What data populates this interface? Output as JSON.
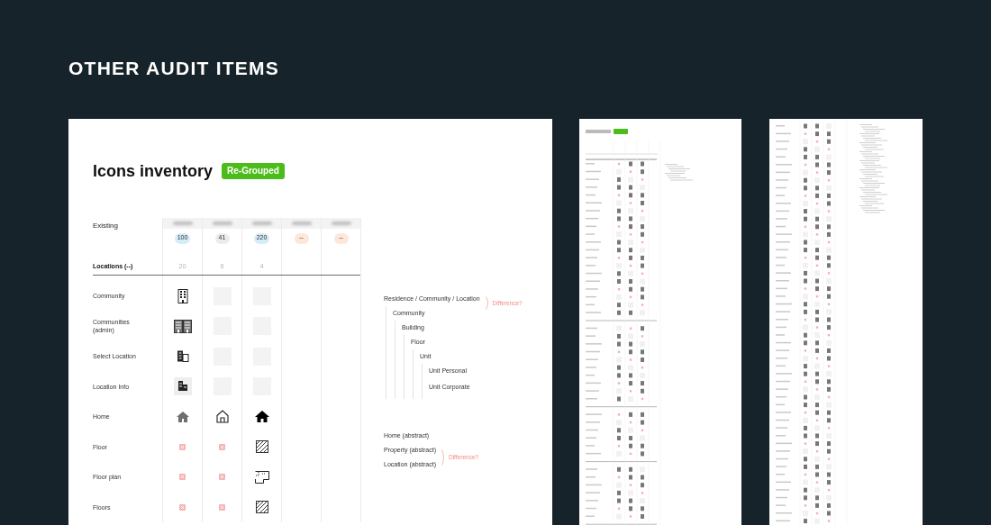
{
  "section_title": "OTHER AUDIT ITEMS",
  "inventory": {
    "title": "Icons inventory",
    "tag": "Re-Grouped",
    "table": {
      "row_header": "Existing",
      "columns": [
        {
          "badge": "100",
          "color": "#d6edf8"
        },
        {
          "badge": "41",
          "color": "#ececec"
        },
        {
          "badge": "220",
          "color": "#d6edf8"
        },
        {
          "badge": "--",
          "color": "#fde7d8"
        },
        {
          "badge": "--",
          "color": "#fde7d8"
        }
      ],
      "group": {
        "label": "Locations (--)",
        "counts": [
          "20",
          "6",
          "4"
        ]
      },
      "rows": [
        {
          "label": "Community",
          "cells": [
            {
              "kind": "tower"
            },
            {
              "kind": "placeholder"
            },
            {
              "kind": "placeholder"
            }
          ]
        },
        {
          "label": "Communities (admin)",
          "cells": [
            {
              "kind": "towers"
            },
            {
              "kind": "placeholder"
            },
            {
              "kind": "placeholder"
            }
          ]
        },
        {
          "label": "Select Location",
          "cells": [
            {
              "kind": "office"
            },
            {
              "kind": "placeholder"
            },
            {
              "kind": "placeholder"
            }
          ]
        },
        {
          "label": "Location Info",
          "cells": [
            {
              "kind": "office-boxed"
            },
            {
              "kind": "placeholder"
            },
            {
              "kind": "placeholder"
            }
          ]
        },
        {
          "label": "Home",
          "cells": [
            {
              "kind": "house-gray"
            },
            {
              "kind": "house-outline"
            },
            {
              "kind": "house-solid"
            }
          ]
        },
        {
          "label": "Floor",
          "cells": [
            {
              "kind": "missing"
            },
            {
              "kind": "missing"
            },
            {
              "kind": "hatch"
            }
          ]
        },
        {
          "label": "Floor plan",
          "cells": [
            {
              "kind": "missing"
            },
            {
              "kind": "missing"
            },
            {
              "kind": "floorplan"
            }
          ]
        },
        {
          "label": "Floors",
          "cells": [
            {
              "kind": "missing"
            },
            {
              "kind": "missing"
            },
            {
              "kind": "hatch"
            }
          ]
        }
      ]
    },
    "tree": {
      "label": "Residence / Community / Location",
      "note": "Difference?",
      "children": [
        {
          "label": "Community",
          "children": [
            {
              "label": "Building",
              "children": [
                {
                  "label": "Floor",
                  "children": [
                    {
                      "label": "Unit",
                      "children": [
                        {
                          "label": "Unit Personal"
                        },
                        {
                          "label": "Unit Corporate"
                        }
                      ]
                    }
                  ]
                }
              ]
            }
          ]
        }
      ]
    },
    "abstract": {
      "items": [
        "Home (abstract)",
        "Property (abstract)",
        "Location (abstract)"
      ],
      "note": "Difference?"
    }
  }
}
